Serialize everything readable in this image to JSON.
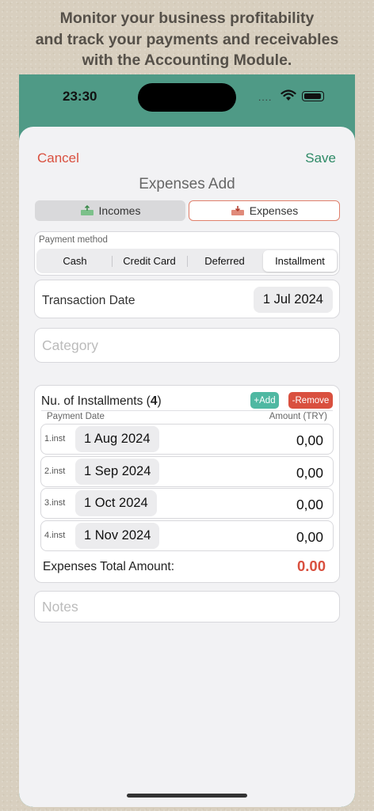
{
  "headline": {
    "line1": "Monitor your business profitability",
    "line2": "and track your payments and receivables",
    "line3_prefix": "with the ",
    "line3_bold": "Accounting Module",
    "line3_suffix": "."
  },
  "status_bar": {
    "time": "23:30",
    "dots": "...."
  },
  "nav": {
    "cancel": "Cancel",
    "save": "Save",
    "title": "Expenses Add"
  },
  "type_segment": {
    "incomes": "Incomes",
    "expenses": "Expenses",
    "selected": "Expenses"
  },
  "payment_method": {
    "label": "Payment method",
    "options": [
      "Cash",
      "Credit Card",
      "Deferred",
      "Installment"
    ],
    "selected": "Installment"
  },
  "transaction": {
    "label": "Transaction Date",
    "value": "1 Jul 2024"
  },
  "category": {
    "placeholder": "Category"
  },
  "installments": {
    "title_prefix": "Nu. of Installments (",
    "count": "4",
    "title_suffix": ")",
    "add_label": "+Add",
    "remove_label": "-Remove",
    "col_date": "Payment Date",
    "col_amount": "Amount (TRY)",
    "rows": [
      {
        "label": "1.inst",
        "date": "1 Aug 2024",
        "amount": "0,00"
      },
      {
        "label": "2.inst",
        "date": "1 Sep 2024",
        "amount": "0,00"
      },
      {
        "label": "3.inst",
        "date": "1 Oct 2024",
        "amount": "0,00"
      },
      {
        "label": "4.inst",
        "date": "1 Nov 2024",
        "amount": "0,00"
      }
    ],
    "total_label": "Expenses Total Amount:",
    "total_value": "0.00"
  },
  "notes": {
    "placeholder": "Notes"
  },
  "colors": {
    "header_green": "#4f9a86",
    "cancel_red": "#d9503f",
    "save_green": "#2e8a66",
    "add_teal": "#4fb8a2",
    "remove_red": "#d9503f"
  }
}
